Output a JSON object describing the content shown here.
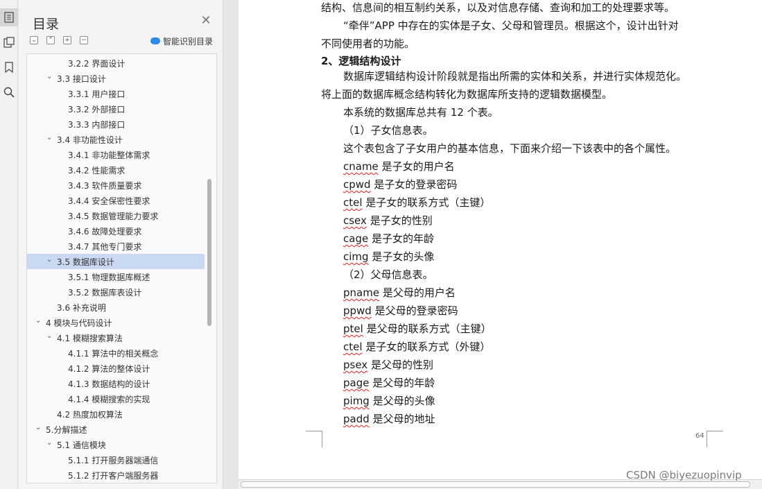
{
  "toc_panel": {
    "title": "目录",
    "smart_recognize_label": "智能识别目录",
    "items": [
      {
        "label": "3.2.2 界面设计",
        "level": 3,
        "expander": "none"
      },
      {
        "label": "3.3 接口设计",
        "level": 2,
        "expander": "expanded"
      },
      {
        "label": "3.3.1 用户接口",
        "level": 3,
        "expander": "none"
      },
      {
        "label": "3.3.2 外部接口",
        "level": 3,
        "expander": "none"
      },
      {
        "label": "3.3.3 内部接口",
        "level": 3,
        "expander": "none"
      },
      {
        "label": "3.4 非功能性设计",
        "level": 2,
        "expander": "expanded"
      },
      {
        "label": "3.4.1  非功能整体需求",
        "level": 3,
        "expander": "none"
      },
      {
        "label": "3.4.2  性能需求",
        "level": 3,
        "expander": "none"
      },
      {
        "label": "3.4.3  软件质量要求",
        "level": 3,
        "expander": "none"
      },
      {
        "label": "3.4.4  安全保密性要求",
        "level": 3,
        "expander": "none"
      },
      {
        "label": "3.4.5  数据管理能力要求",
        "level": 3,
        "expander": "none"
      },
      {
        "label": "3.4.6  故障处理要求",
        "level": 3,
        "expander": "none"
      },
      {
        "label": "3.4.7  其他专门要求",
        "level": 3,
        "expander": "none"
      },
      {
        "label": "3.5  数据库设计",
        "level": 2,
        "expander": "expanded",
        "selected": true
      },
      {
        "label": "3.5.1 物理数据库概述",
        "level": 3,
        "expander": "none"
      },
      {
        "label": "3.5.2 数据库表设计",
        "level": 3,
        "expander": "none"
      },
      {
        "label": "3.6 补充说明",
        "level": 2,
        "expander": "none"
      },
      {
        "label": "4  模块与代码设计",
        "level": 1,
        "expander": "expanded"
      },
      {
        "label": "4.1  模糊搜索算法",
        "level": 2,
        "expander": "expanded"
      },
      {
        "label": "4.1.1 算法中的相关概念",
        "level": 3,
        "expander": "none"
      },
      {
        "label": "4.1.2 算法的整体设计",
        "level": 3,
        "expander": "none"
      },
      {
        "label": "4.1.3 数据结构的设计",
        "level": 3,
        "expander": "none"
      },
      {
        "label": "4.1.4 模糊搜索的实现",
        "level": 3,
        "expander": "none"
      },
      {
        "label": "4.2  热度加权算法",
        "level": 2,
        "expander": "none"
      },
      {
        "label": "5.分解描述",
        "level": 1,
        "expander": "expanded"
      },
      {
        "label": "5.1 通信模块",
        "level": 2,
        "expander": "expanded"
      },
      {
        "label": "5.1.1 打开服务器端通信",
        "level": 3,
        "expander": "none"
      },
      {
        "label": "5.1.2 打开客户端服务器",
        "level": 3,
        "expander": "none"
      }
    ]
  },
  "document": {
    "lines": [
      {
        "text": "结构、信息间的相互制约关系，以及对信息存储、查询和加工的处理要求等。",
        "indent": 0,
        "bold": false
      },
      {
        "text": "“牵伴”APP 中存在的实体是子女、父母和管理员。根据这个，设计出针对",
        "indent": 1,
        "bold": false
      },
      {
        "text": "不同使用者的功能。",
        "indent": 0,
        "bold": false
      },
      {
        "text": "2、逻辑结构设计",
        "indent": 0,
        "bold": true
      },
      {
        "text": "数据库逻辑结构设计阶段就是指出所需的实体和关系，并进行实体规范化。",
        "indent": 1,
        "bold": false
      },
      {
        "text": "将上面的数据库概念结构转化为数据库所支持的逻辑数据模型。",
        "indent": 0,
        "bold": false
      },
      {
        "text": "本系统的数据库总共有 12 个表。",
        "indent": 1,
        "bold": false
      },
      {
        "text": "（1）子女信息表。",
        "indent": 1,
        "bold": false
      },
      {
        "text": "这个表包含了子女用户的基本信息，下面来介绍一下该表中的各个属性。",
        "indent": 1,
        "bold": false
      },
      {
        "attr": "cname",
        "text": "是子女的用户名",
        "indent": 1,
        "bold": false
      },
      {
        "attr": "cpwd",
        "text": "是子女的登录密码",
        "indent": 1,
        "bold": false
      },
      {
        "attr": "ctel",
        "text": "是子女的联系方式（主键）",
        "indent": 1,
        "bold": false
      },
      {
        "attr": "csex",
        "text": "是子女的性别",
        "indent": 1,
        "bold": false
      },
      {
        "attr": "cage",
        "text": "是子女的年龄",
        "indent": 1,
        "bold": false
      },
      {
        "attr": "cimg",
        "text": "是子女的头像",
        "indent": 1,
        "bold": false
      },
      {
        "text": "（2）父母信息表。",
        "indent": 1,
        "bold": false
      },
      {
        "attr": "pname",
        "text": "是父母的用户名",
        "indent": 1,
        "bold": false
      },
      {
        "attr": "ppwd",
        "text": "是父母的登录密码",
        "indent": 1,
        "bold": false
      },
      {
        "attr": "ptel",
        "text": "是父母的联系方式（主键）",
        "indent": 1,
        "bold": false
      },
      {
        "attr": "ctel",
        "text": "是子女的联系方式（外键）",
        "indent": 1,
        "bold": false
      },
      {
        "attr": "psex",
        "text": "是父母的性别",
        "indent": 1,
        "bold": false
      },
      {
        "attr": "page",
        "text": "是父母的年龄",
        "indent": 1,
        "bold": false
      },
      {
        "attr": "pimg",
        "text": "是父母的头像",
        "indent": 1,
        "bold": false
      },
      {
        "attr": "padd",
        "text": "是父母的地址",
        "indent": 1,
        "bold": false
      }
    ],
    "page_number": "64"
  },
  "watermark": "CSDN @biyezuopinvip",
  "colors": {
    "selected_row": "#c9d9f2",
    "spellcheck_underline": "#e02020",
    "accent_blue": "#2e89e8"
  }
}
